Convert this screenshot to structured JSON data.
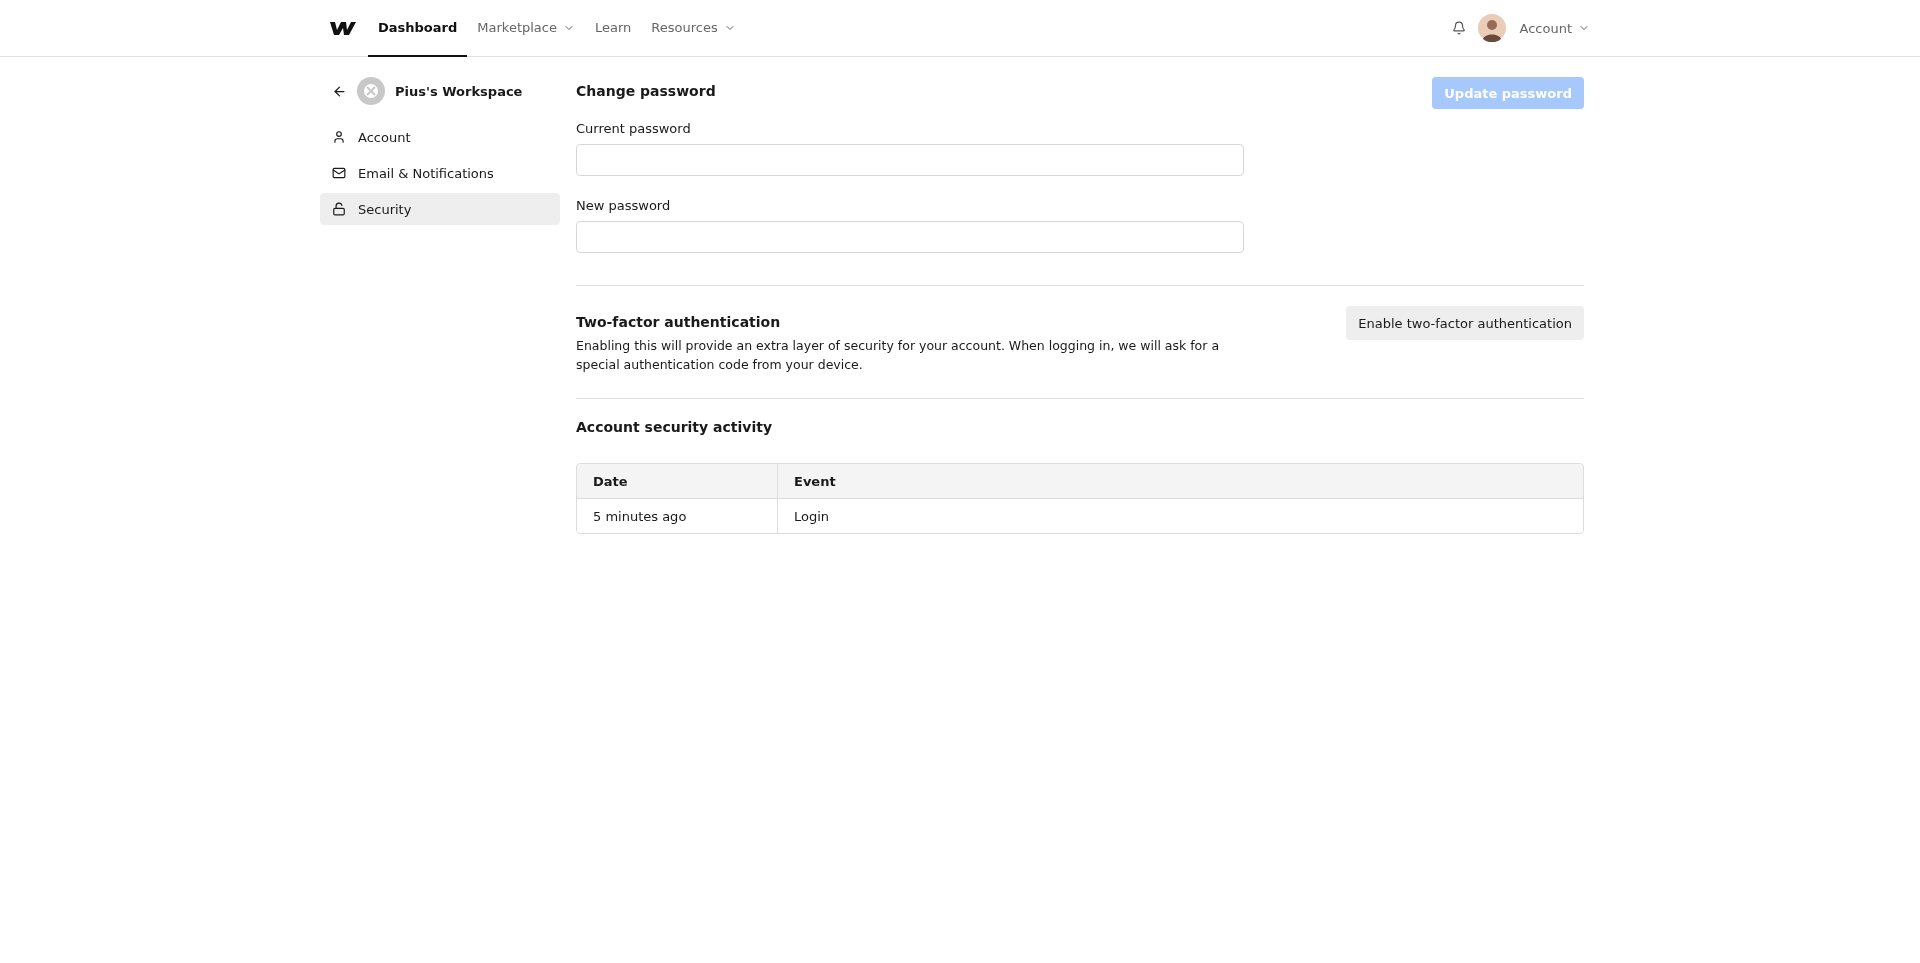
{
  "nav": {
    "items": [
      {
        "label": "Dashboard",
        "selected": true,
        "has_menu": false
      },
      {
        "label": "Marketplace",
        "selected": false,
        "has_menu": true
      },
      {
        "label": "Learn",
        "selected": false,
        "has_menu": false
      },
      {
        "label": "Resources",
        "selected": false,
        "has_menu": true
      }
    ],
    "account": {
      "label": "Account"
    }
  },
  "sidebar": {
    "workspace": "Pius's Workspace",
    "items": [
      {
        "label": "Account",
        "selected": false
      },
      {
        "label": "Email & Notifications",
        "selected": false
      },
      {
        "label": "Security",
        "selected": true
      }
    ]
  },
  "change_password": {
    "title": "Change password",
    "button": {
      "label": "Update password",
      "disabled": true
    },
    "fields": [
      {
        "label": "Current password"
      },
      {
        "label": "New password"
      }
    ]
  },
  "two_factor": {
    "title": "Two-factor authentication",
    "description": "Enabling this will provide an extra layer of security for your account. When logging in, we will ask for a special authentication code from your device.",
    "button": "Enable two-factor authentication"
  },
  "activity": {
    "title": "Account security activity",
    "columns": [
      "Date",
      "Event"
    ],
    "rows": [
      [
        "5 minutes ago",
        "Login"
      ]
    ]
  }
}
